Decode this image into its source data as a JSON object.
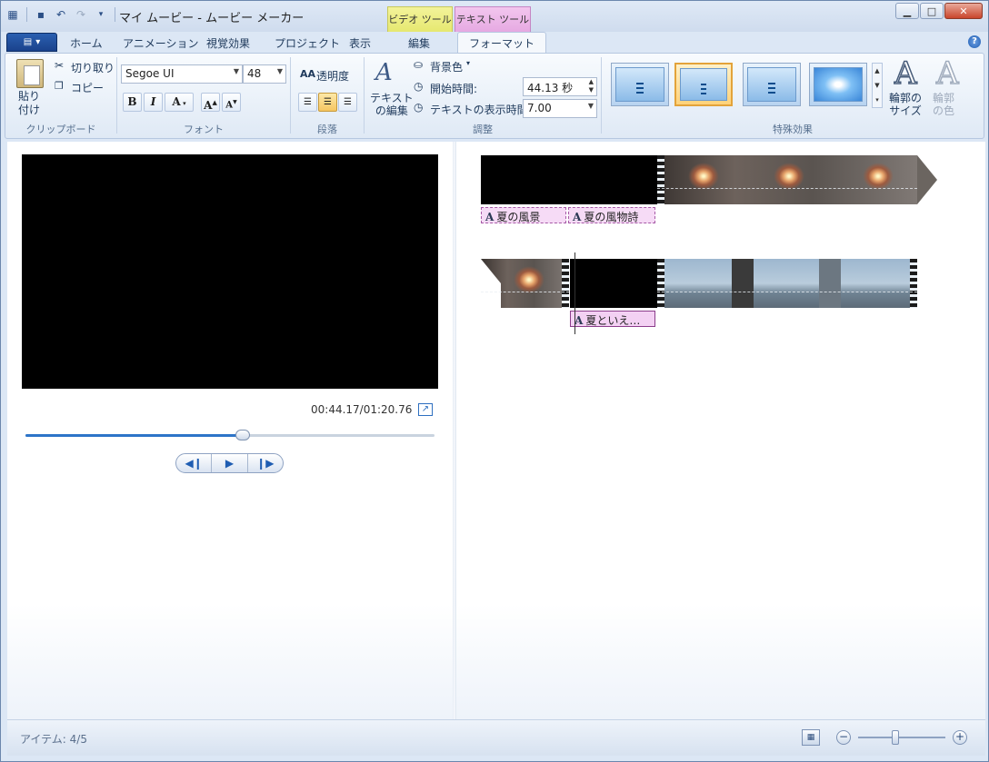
{
  "window": {
    "title": "マイ ムービー - ムービー メーカー",
    "context_tabs": {
      "video_tools": "ビデオ ツール",
      "text_tools": "テキスト ツール"
    }
  },
  "tabs": [
    {
      "label": "ホーム"
    },
    {
      "label": "アニメーション"
    },
    {
      "label": "視覚効果"
    },
    {
      "label": "プロジェクト"
    },
    {
      "label": "表示"
    },
    {
      "label": "編集"
    },
    {
      "label": "フォーマット",
      "active": true
    }
  ],
  "ribbon": {
    "clipboard": {
      "paste": "貼り\n付け",
      "cut": "切り取り",
      "copy": "コピー",
      "label": "クリップボード"
    },
    "font": {
      "family": "Segoe UI",
      "size": "48",
      "bold": "B",
      "italic": "I",
      "color": "A",
      "grow": "A",
      "shrink": "A",
      "label": "フォント"
    },
    "paragraph": {
      "transparency": "透明度",
      "label": "段落"
    },
    "adjust": {
      "edit_text": "テキスト\nの編集",
      "background_color": "背景色",
      "start_time_label": "開始時間:",
      "start_time_value": "44.13 秒",
      "duration_label": "テキストの表示時間:",
      "duration_value": "7.00",
      "label": "調整"
    },
    "effects": {
      "label": "特殊効果",
      "outline_size": "輪郭の\nサイズ",
      "outline_color": "輪郭\nの色",
      "selected_index": 1
    }
  },
  "preview": {
    "timecode": "00:44.17/01:20.76",
    "seek_progress": 0.53
  },
  "storyboard": {
    "captions": [
      "夏の風景",
      "夏の風物詩",
      "夏といえ…"
    ]
  },
  "status": {
    "items": "アイテム: 4/5",
    "zoom_level": 0.43
  },
  "colors": {
    "accent": "#2d74c8",
    "caption_bg": "#f6dbf6",
    "text_tools": "#e6a9e2",
    "video_tools": "#e6e870"
  }
}
